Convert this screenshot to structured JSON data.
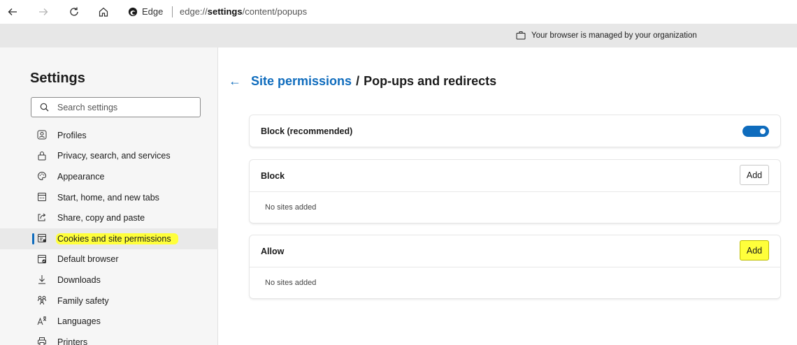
{
  "toolbar": {
    "back_icon": "arrow-left-icon",
    "forward_icon": "arrow-right-icon",
    "refresh_icon": "refresh-icon",
    "home_icon": "home-icon",
    "site_name": "Edge",
    "url_prefix": "edge://",
    "url_bold": "settings",
    "url_suffix": "/content/popups"
  },
  "banner": {
    "text": "Your browser is managed by your organization",
    "icon": "briefcase-icon"
  },
  "sidebar": {
    "title": "Settings",
    "search_placeholder": "Search settings",
    "items": [
      {
        "label": "Profiles",
        "icon": "profile-icon"
      },
      {
        "label": "Privacy, search, and services",
        "icon": "lock-icon"
      },
      {
        "label": "Appearance",
        "icon": "palette-icon"
      },
      {
        "label": "Start, home, and new tabs",
        "icon": "start-tabs-icon"
      },
      {
        "label": "Share, copy and paste",
        "icon": "share-icon"
      },
      {
        "label": "Cookies and site permissions",
        "icon": "cookies-permissions-icon",
        "active": true
      },
      {
        "label": "Default browser",
        "icon": "default-browser-icon"
      },
      {
        "label": "Downloads",
        "icon": "download-icon"
      },
      {
        "label": "Family safety",
        "icon": "family-icon"
      },
      {
        "label": "Languages",
        "icon": "languages-icon"
      },
      {
        "label": "Printers",
        "icon": "printer-icon"
      }
    ]
  },
  "main": {
    "breadcrumb": {
      "parent": "Site permissions",
      "separator": "/",
      "current": "Pop-ups and redirects"
    },
    "block_recommended": {
      "label": "Block (recommended)",
      "toggle_on": true
    },
    "block_section": {
      "label": "Block",
      "add_label": "Add",
      "empty_text": "No sites added"
    },
    "allow_section": {
      "label": "Allow",
      "add_label": "Add",
      "empty_text": "No sites added"
    }
  },
  "colors": {
    "accent": "#0f6cbd",
    "highlight": "#ffff3b",
    "sidebar_bg": "#f6f6f6",
    "banner_bg": "#e7e7e7"
  }
}
